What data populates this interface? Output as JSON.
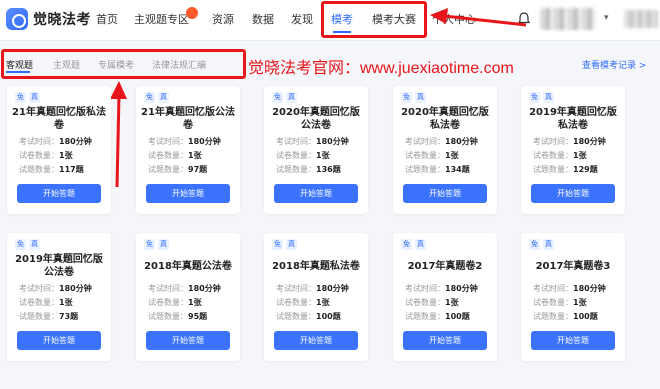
{
  "brand": {
    "logo_text": "觉晓法考"
  },
  "nav": {
    "items": [
      "首页",
      "主观题专区",
      "资源",
      "数据",
      "发现",
      "模考",
      "模考大赛",
      "个人中心"
    ],
    "hot_badge": "new"
  },
  "subtabs": [
    "客观题",
    "主观题",
    "专属模考",
    "法律法规汇编"
  ],
  "watermark": "觉晓法考官网：www.juexiaotime.com",
  "record_link": "查看模考记录 >",
  "labels": {
    "time": "考试时间：",
    "count": "试卷数量：",
    "questions": "试题数量："
  },
  "tags": [
    "免",
    "真"
  ],
  "cards": [
    {
      "title": "21年真题回忆版私法卷",
      "time": "180分钟",
      "count": "1张",
      "questions": "117题",
      "button": "开始答题"
    },
    {
      "title": "21年真题回忆版公法卷",
      "time": "180分钟",
      "count": "1张",
      "questions": "97题",
      "button": "开始答题"
    },
    {
      "title": "2020年真题回忆版公法卷",
      "time": "180分钟",
      "count": "1张",
      "questions": "136题",
      "button": "开始答题"
    },
    {
      "title": "2020年真题回忆版私法卷",
      "time": "180分钟",
      "count": "1张",
      "questions": "134题",
      "button": "开始答题"
    },
    {
      "title": "2019年真题回忆版私法卷",
      "time": "180分钟",
      "count": "1张",
      "questions": "129题",
      "button": "开始答题"
    },
    {
      "title": "2019年真题回忆版公法卷",
      "time": "180分钟",
      "count": "1张",
      "questions": "73题",
      "button": "开始答题"
    },
    {
      "title": "2018年真题公法卷",
      "time": "180分钟",
      "count": "1张",
      "questions": "95题",
      "button": "开始答题"
    },
    {
      "title": "2018年真题私法卷",
      "time": "180分钟",
      "count": "1张",
      "questions": "100题",
      "button": "开始答题"
    },
    {
      "title": "2017年真题卷2",
      "time": "180分钟",
      "count": "1张",
      "questions": "100题",
      "button": "开始答题"
    },
    {
      "title": "2017年真题卷3",
      "time": "180分钟",
      "count": "1张",
      "questions": "100题",
      "button": "开始答题"
    }
  ],
  "colors": {
    "accent": "#2f6bff",
    "button": "#3b73ff",
    "annotation": "#e8161b",
    "background": "#f4f6f9"
  }
}
